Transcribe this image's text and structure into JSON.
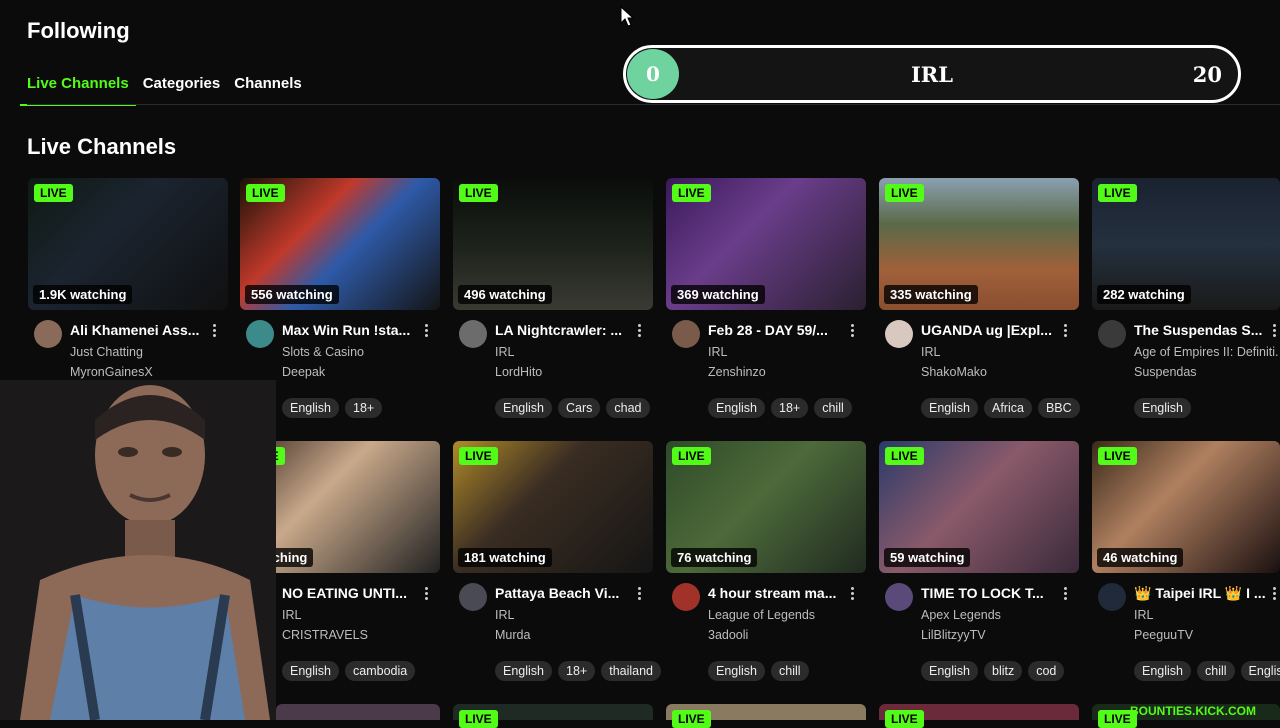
{
  "header": {
    "title": "Following"
  },
  "tabs": [
    {
      "label": "Live Channels"
    },
    {
      "label": "Categories"
    },
    {
      "label": "Channels"
    }
  ],
  "section": {
    "title": "Live Channels"
  },
  "slider": {
    "min": "0",
    "label": "IRL",
    "max": "20",
    "value": 0
  },
  "live_label": "LIVE",
  "cards_row1": [
    {
      "viewers": "1.9K watching",
      "title": "Ali Khamenei Ass...",
      "category": "Just Chatting",
      "streamer": "MyronGainesX",
      "tags": []
    },
    {
      "viewers": "556 watching",
      "title": "Max Win Run !sta...",
      "category": "Slots & Casino",
      "streamer": "Deepak",
      "tags": [
        "English",
        "18+"
      ]
    },
    {
      "viewers": "496 watching",
      "title": "LA Nightcrawler: ...",
      "category": "IRL",
      "streamer": "LordHito",
      "tags": [
        "English",
        "Cars",
        "chad"
      ]
    },
    {
      "viewers": "369 watching",
      "title": "Feb 28 - DAY 59/...",
      "category": "IRL",
      "streamer": "Zenshinzo",
      "tags": [
        "English",
        "18+",
        "chill"
      ]
    },
    {
      "viewers": "335 watching",
      "title": "UGANDA ug |Expl...",
      "category": "IRL",
      "streamer": "ShakoMako",
      "tags": [
        "English",
        "Africa",
        "BBC"
      ]
    },
    {
      "viewers": "282 watching",
      "title": "The Suspendas S...",
      "category": "Age of Empires II: Definiti...",
      "streamer": "Suspendas",
      "tags": [
        "English"
      ]
    }
  ],
  "cards_row2": [
    {
      "viewers": "watching",
      "title": "NO EATING UNTI...",
      "category": "IRL",
      "streamer": "CRISTRAVELS",
      "tags": [
        "English",
        "cambodia"
      ]
    },
    {
      "viewers": "181 watching",
      "title": "Pattaya Beach Vi...",
      "category": "IRL",
      "streamer": "Murda",
      "tags": [
        "English",
        "18+",
        "thailand"
      ]
    },
    {
      "viewers": "76 watching",
      "title": "4 hour stream ma...",
      "category": "League of Legends",
      "streamer": "3adooli",
      "tags": [
        "English",
        "chill"
      ]
    },
    {
      "viewers": "59 watching",
      "title": "TIME TO LOCK T...",
      "category": "Apex Legends",
      "streamer": "LilBlitzyyTV",
      "tags": [
        "English",
        "blitz",
        "cod"
      ]
    },
    {
      "viewers": "46 watching",
      "title": "👑 Taipei IRL 👑 I ...",
      "category": "IRL",
      "streamer": "PeeguuTV",
      "tags": [
        "English",
        "chill",
        "English"
      ]
    }
  ],
  "bottom_banner": "BOUNTIES.KICK.COM",
  "colors": {
    "accent": "#53fc18",
    "slider_knob": "#6fd39f",
    "background": "#0b0b0b"
  }
}
